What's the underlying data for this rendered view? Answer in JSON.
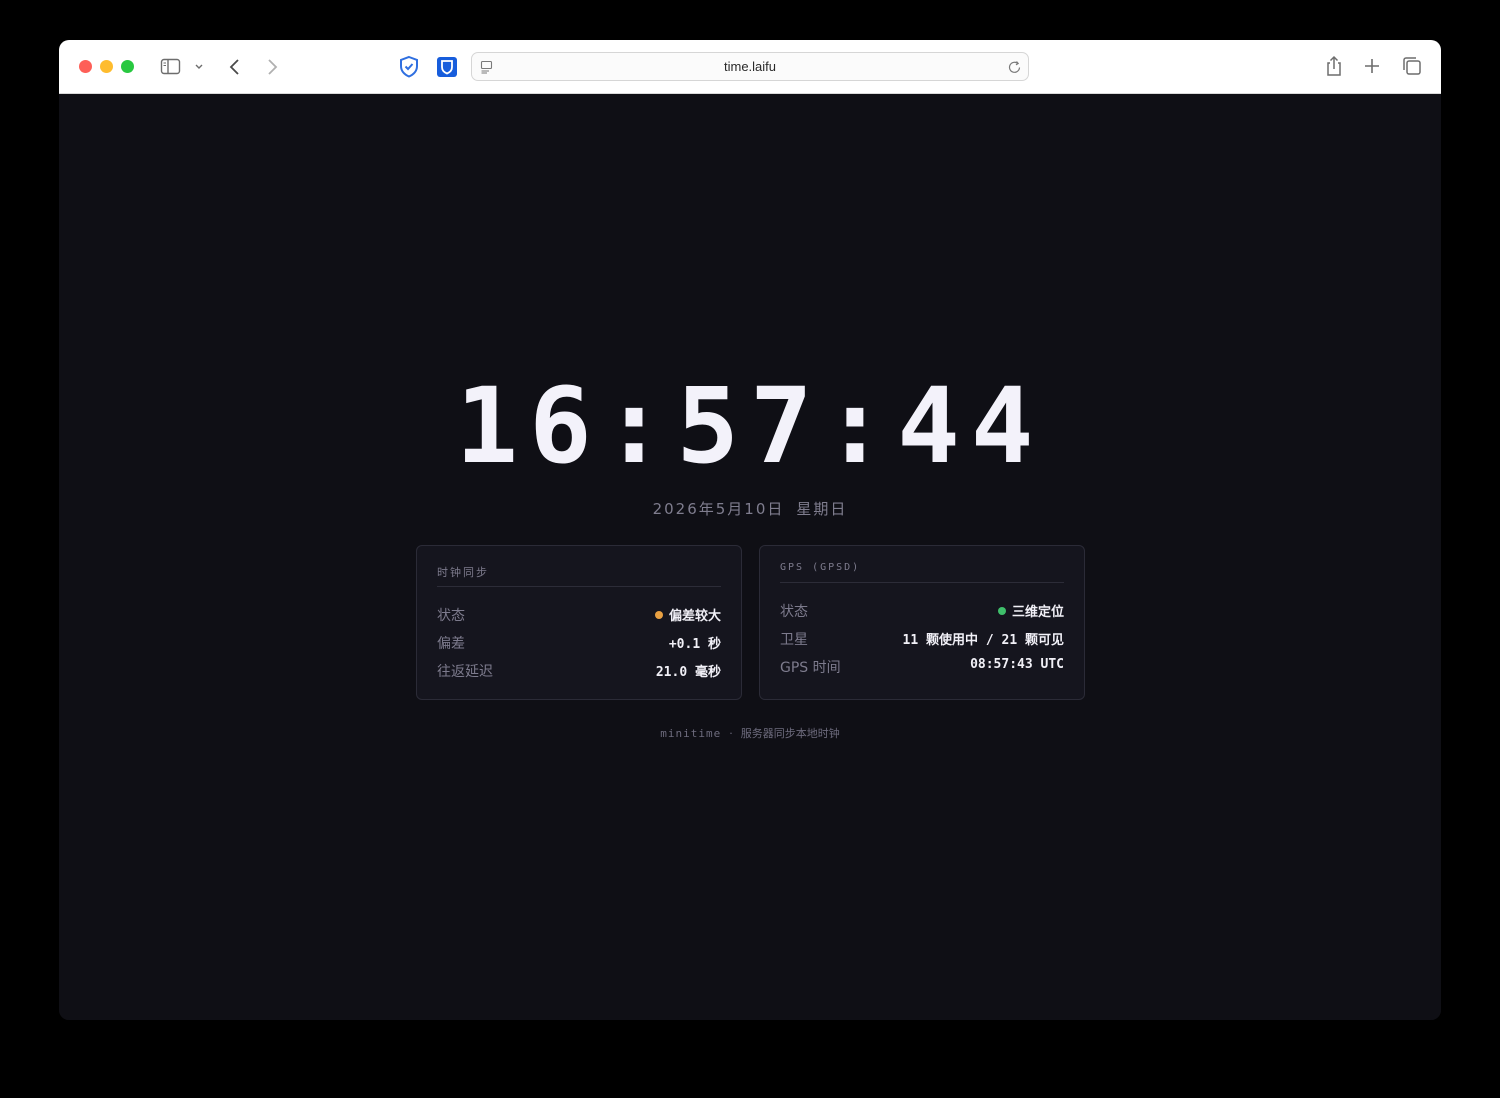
{
  "browser": {
    "url": "time.laifu",
    "icons": {
      "sidebar": "sidebar-icon",
      "chevron": "chevron-down-icon",
      "back": "back-arrow-icon",
      "forward": "forward-arrow-icon",
      "privacy": "shield-check-icon",
      "password_manager": "bitwarden-shield-icon",
      "reader": "reader-icon",
      "reload": "reload-icon",
      "share": "share-icon",
      "new_tab": "plus-icon",
      "tabs": "tabs-overview-icon"
    }
  },
  "clock": {
    "time": "16:57:44",
    "date": "2026年5月10日",
    "weekday": "星期日"
  },
  "cards": {
    "sync": {
      "title": "时钟同步",
      "rows": [
        {
          "label": "状态",
          "value": "偏差较大",
          "status_color": "#e8a042"
        },
        {
          "label": "偏差",
          "value": "+0.1 秒"
        },
        {
          "label": "往返延迟",
          "value": "21.0 毫秒"
        }
      ]
    },
    "gps": {
      "title": "GPS (GPSD)",
      "rows": [
        {
          "label": "状态",
          "value": "三维定位",
          "status_color": "#3fbf6b"
        },
        {
          "label": "卫星",
          "value": "11 颗使用中 / 21 颗可见"
        },
        {
          "label": "GPS 时间",
          "value": "08:57:43 UTC"
        }
      ]
    }
  },
  "footer": {
    "brand": "minitime",
    "separator": "·",
    "tagline": "服务器同步本地时钟"
  }
}
